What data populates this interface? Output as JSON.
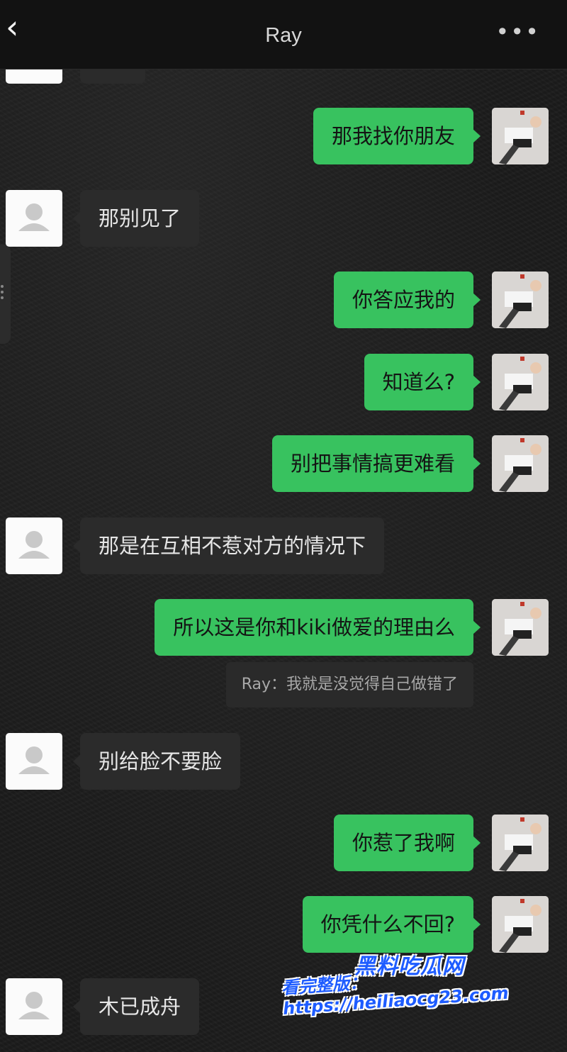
{
  "header": {
    "back_icon": "‹",
    "title": "Ray",
    "more_icon": "•••"
  },
  "messages": [
    {
      "side": "right",
      "text": "那我找你朋友"
    },
    {
      "side": "left",
      "text": "那别见了"
    },
    {
      "side": "right",
      "text": "你答应我的"
    },
    {
      "side": "right",
      "text": "知道么?"
    },
    {
      "side": "right",
      "text": "别把事情搞更难看"
    },
    {
      "side": "left",
      "text": "那是在互相不惹对方的情况下"
    },
    {
      "side": "right",
      "text": "所以这是你和kiki做爱的理由么"
    },
    {
      "side": "left",
      "text": "别给脸不要脸"
    },
    {
      "side": "right",
      "text": "你惹了我啊"
    },
    {
      "side": "right",
      "text": "你凭什么不回?"
    },
    {
      "side": "left",
      "text": "木已成舟"
    }
  ],
  "quote": {
    "text": "Ray：我就是没觉得自己做错了"
  },
  "watermark": {
    "brand": "黑料吃瓜网",
    "url_line": "看完整版：https://heiliaocg23.com"
  },
  "colors": {
    "sent_bubble": "#38c25f",
    "received_bubble": "#2b2b2b",
    "watermark": "#1e5cff"
  }
}
